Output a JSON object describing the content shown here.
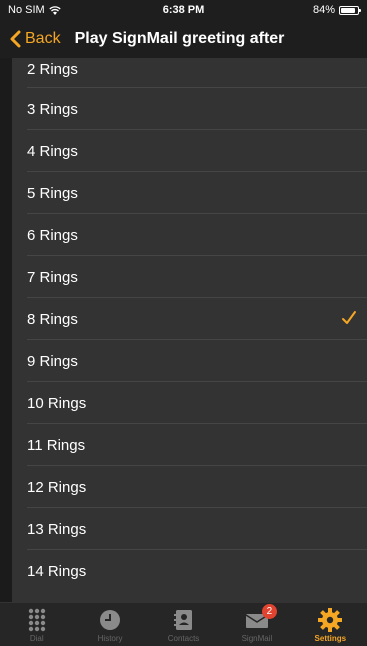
{
  "status_bar": {
    "carrier": "No SIM",
    "time": "6:38 PM",
    "battery_text": "84%",
    "battery_level": 0.84
  },
  "nav": {
    "back_label": "Back",
    "title": "Play SignMail greeting after"
  },
  "list": {
    "items": [
      {
        "label": "2 Rings",
        "selected": false
      },
      {
        "label": "3 Rings",
        "selected": false
      },
      {
        "label": "4 Rings",
        "selected": false
      },
      {
        "label": "5 Rings",
        "selected": false
      },
      {
        "label": "6 Rings",
        "selected": false
      },
      {
        "label": "7 Rings",
        "selected": false
      },
      {
        "label": "8 Rings",
        "selected": true
      },
      {
        "label": "9 Rings",
        "selected": false
      },
      {
        "label": "10 Rings",
        "selected": false
      },
      {
        "label": "11 Rings",
        "selected": false
      },
      {
        "label": "12 Rings",
        "selected": false
      },
      {
        "label": "13 Rings",
        "selected": false
      },
      {
        "label": "14 Rings",
        "selected": false
      }
    ]
  },
  "tabs": [
    {
      "label": "Dial",
      "icon": "dialpad-icon",
      "active": false
    },
    {
      "label": "History",
      "icon": "clock-icon",
      "active": false
    },
    {
      "label": "Contacts",
      "icon": "contacts-icon",
      "active": false
    },
    {
      "label": "SignMail",
      "icon": "envelope-icon",
      "active": false,
      "badge": "2"
    },
    {
      "label": "Settings",
      "icon": "gear-icon",
      "active": true
    }
  ],
  "colors": {
    "accent": "#f5a623",
    "badge": "#e0432f",
    "list_bg": "#333333",
    "bar_bg": "#1e1e1e"
  }
}
